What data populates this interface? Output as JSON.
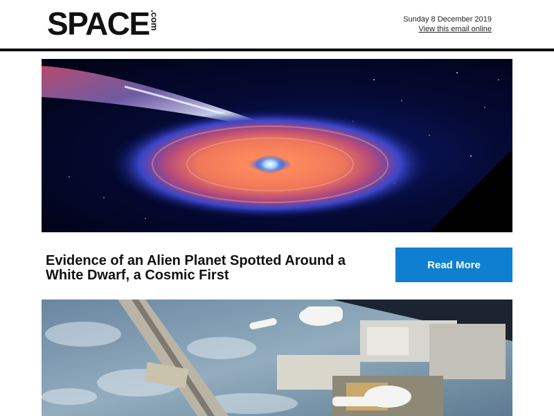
{
  "header": {
    "logo_text": "SPACE",
    "logo_domain": ".com",
    "date": "Sunday 8 December 2019",
    "view_online": "View this email online"
  },
  "articles": [
    {
      "title": "Evidence of an Alien Planet Spotted Around a White Dwarf, a Cosmic First",
      "button_label": "Read More"
    }
  ],
  "colors": {
    "accent": "#0f7fd1",
    "divider": "#000000",
    "text": "#111111"
  },
  "icons": [
    "comet-disk-illustration",
    "iss-spacewalk-photo"
  ]
}
